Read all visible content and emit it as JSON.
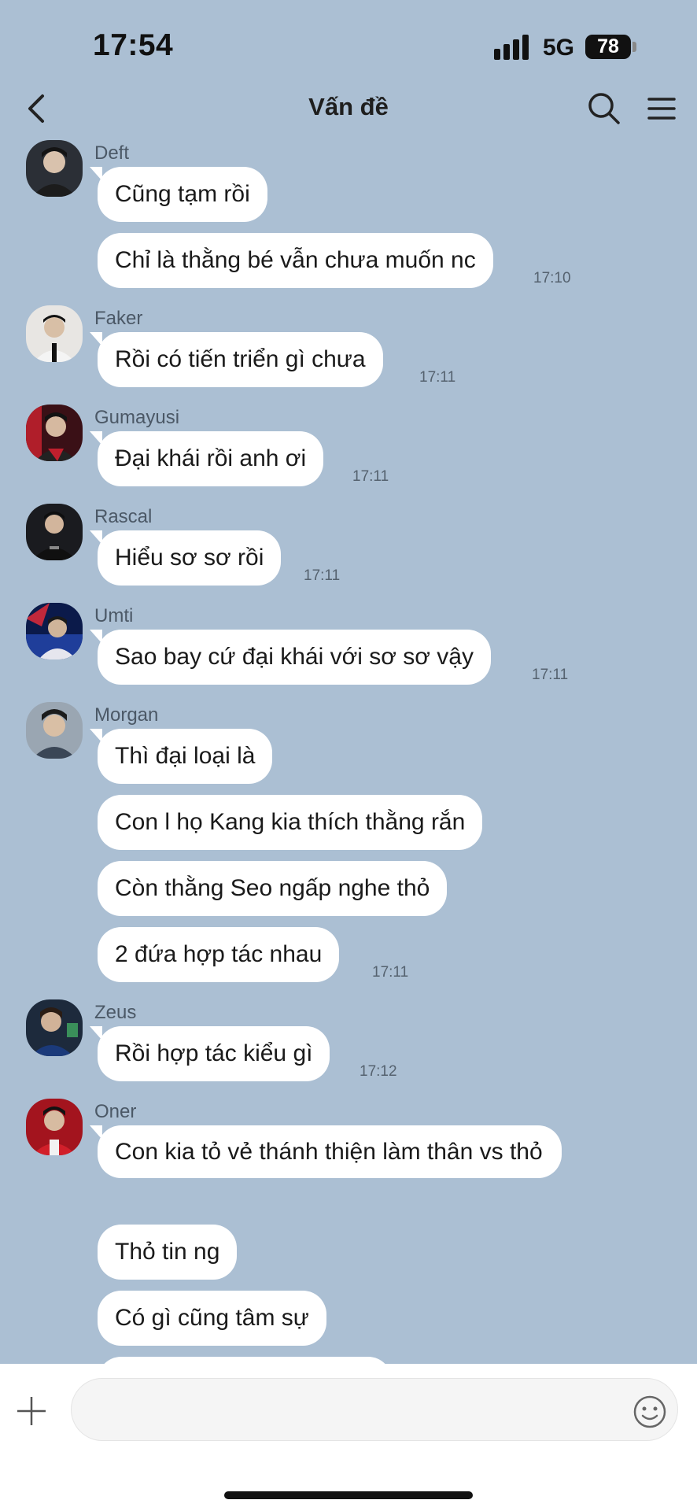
{
  "status": {
    "time": "17:54",
    "network": "5G",
    "battery": "78"
  },
  "header": {
    "title": "Vấn đề"
  },
  "messages": [
    {
      "sender": "Deft",
      "bubbles": [
        "Cũng tạm rồi",
        "Chỉ là thằng bé vẫn chưa muốn nc"
      ],
      "time": "17:10"
    },
    {
      "sender": "Faker",
      "bubbles": [
        "Rồi có tiến triển gì chưa"
      ],
      "time": "17:11"
    },
    {
      "sender": "Gumayusi",
      "bubbles": [
        "Đại khái rồi anh ơi"
      ],
      "time": "17:11"
    },
    {
      "sender": "Rascal",
      "bubbles": [
        "Hiểu sơ sơ rồi"
      ],
      "time": "17:11"
    },
    {
      "sender": "Umti",
      "bubbles": [
        "Sao bay cứ đại khái với sơ sơ vậy"
      ],
      "time": "17:11"
    },
    {
      "sender": "Morgan",
      "bubbles": [
        "Thì đại loại là",
        "Con l họ Kang kia thích thằng rắn",
        "Còn thằng Seo ngấp nghe thỏ",
        "2 đứa hợp tác nhau"
      ],
      "time": "17:11"
    },
    {
      "sender": "Zeus",
      "bubbles": [
        "Rồi hợp tác kiểu gì"
      ],
      "time": "17:12"
    },
    {
      "sender": "Oner",
      "bubbles": [
        "Con kia tỏ vẻ thánh thiện làm thân vs thỏ",
        "Thỏ tin ng",
        "Có gì cũng tâm sự"
      ]
    }
  ],
  "colors": {
    "background": "#abbfd3",
    "bubble": "#ffffff",
    "input_bar": "#ffffff"
  },
  "icons": {
    "back": "chevron-left-icon",
    "search": "search-icon",
    "menu": "hamburger-menu-icon",
    "add": "plus-icon",
    "emoji": "smiley-icon"
  }
}
